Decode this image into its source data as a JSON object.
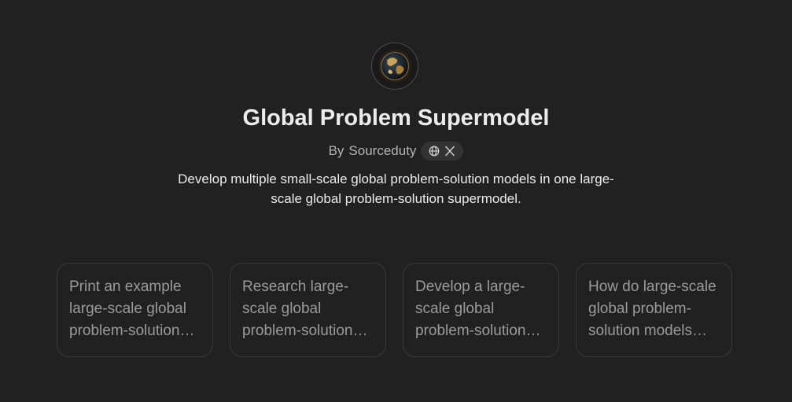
{
  "gpt": {
    "title": "Global Problem Supermodel",
    "byline_prefix": "By",
    "author": "Sourceduty",
    "description": "Develop multiple small-scale global problem-solution models in one large-scale global problem-solution supermodel.",
    "avatar_icon": "globe-image-icon"
  },
  "social_links": [
    {
      "icon": "globe-icon"
    },
    {
      "icon": "x-logo-icon"
    }
  ],
  "starters": [
    {
      "text": "Print an example large-scale global problem-solution supermodel."
    },
    {
      "text": "Research large-scale global problem-solution models."
    },
    {
      "text": "Develop a large-scale global problem-solution supermodel."
    },
    {
      "text": "How do large-scale global problem-solution models work?"
    }
  ],
  "colors": {
    "background": "#212121",
    "card_border": "#3a3a3a",
    "pill_background": "#333333"
  }
}
